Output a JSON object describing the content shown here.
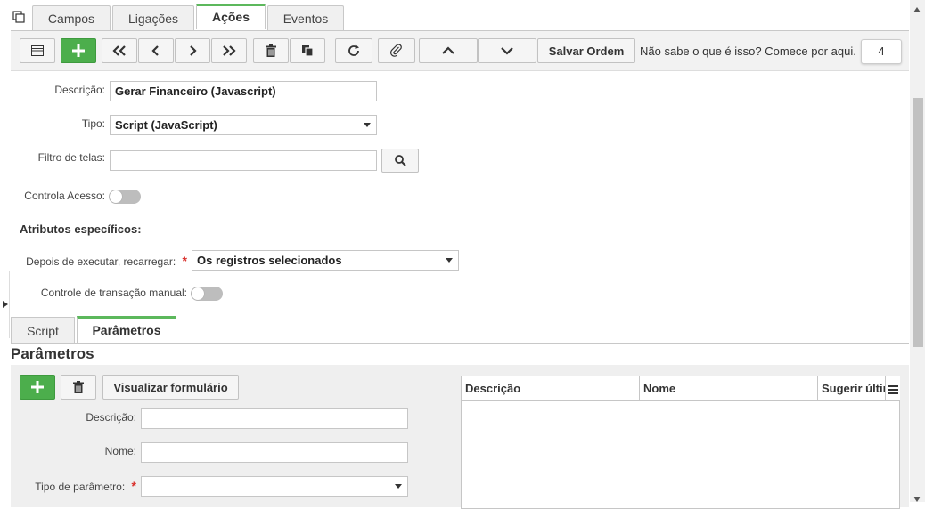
{
  "top_tabs": [
    "Campos",
    "Ligações",
    "Ações",
    "Eventos"
  ],
  "active_top_tab": "Ações",
  "toolbar": {
    "save_order_label": "Salvar Ordem",
    "help_text": "Não sabe o que é isso? Comece por aqui.",
    "help_count": "4"
  },
  "form": {
    "descricao_label": "Descrição:",
    "descricao_value": "Gerar Financeiro (Javascript)",
    "tipo_label": "Tipo:",
    "tipo_value": "Script (JavaScript)",
    "filtro_label": "Filtro de telas:",
    "filtro_value": "",
    "controla_acesso_label": "Controla Acesso:",
    "atributos_title": "Atributos específicos:",
    "recarregar_label": "Depois de executar, recarregar:",
    "recarregar_value": "Os registros selecionados",
    "transacao_label": "Controle de transação manual:",
    "required_mark": "*"
  },
  "sub_tabs": [
    "Script",
    "Parâmetros"
  ],
  "parametros": {
    "title": "Parâmetros",
    "visualizar_label": "Visualizar formulário",
    "descricao_label": "Descrição:",
    "nome_label": "Nome:",
    "tipo_label": "Tipo de parâmetro:",
    "grid_headers": [
      "Descrição",
      "Nome",
      "Sugerir últim"
    ]
  }
}
